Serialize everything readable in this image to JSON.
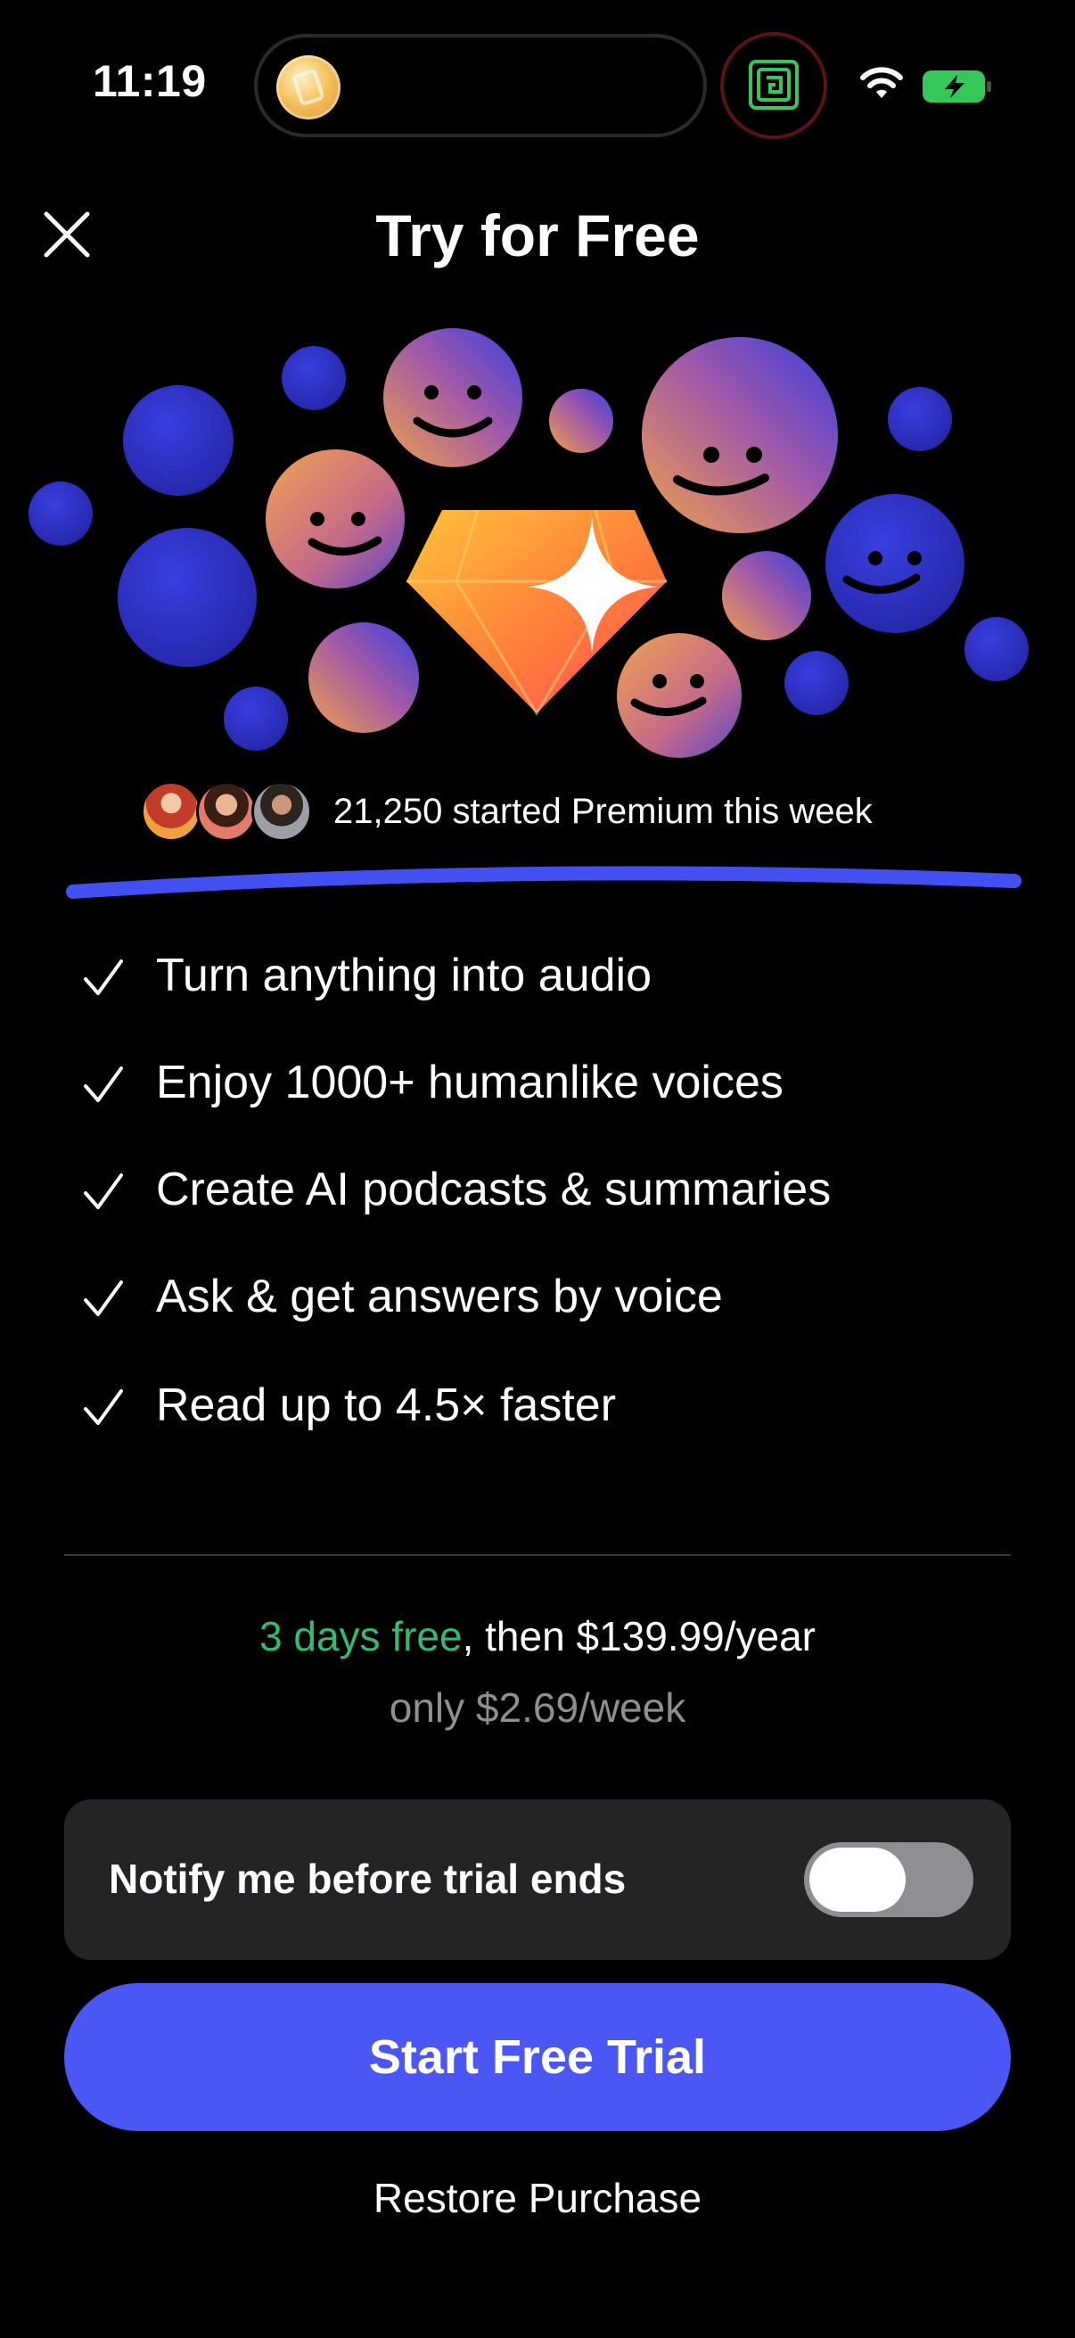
{
  "status_bar": {
    "time": "11:19",
    "icons": [
      "coin-app-icon",
      "screen-record-icon",
      "wifi-icon",
      "battery-charging-icon"
    ]
  },
  "header": {
    "title": "Try for Free",
    "close_icon": "close-icon"
  },
  "social_proof": {
    "text": "21,250 started Premium this week"
  },
  "features": [
    {
      "icon": "check-icon",
      "label": "Turn anything into audio"
    },
    {
      "icon": "check-icon",
      "label": "Enjoy 1000+ humanlike voices"
    },
    {
      "icon": "check-icon",
      "label": "Create AI podcasts & summaries"
    },
    {
      "icon": "check-icon",
      "label": "Ask & get answers by voice"
    },
    {
      "icon": "check-icon",
      "label": "Read up to 4.5× faster"
    }
  ],
  "pricing": {
    "trial": "3 days free",
    "then": ", then $139.99/year",
    "weekly": "only $2.69/week"
  },
  "notify": {
    "label": "Notify me before trial ends",
    "enabled": false
  },
  "cta": {
    "label": "Start Free Trial"
  },
  "restore": {
    "label": "Restore Purchase"
  },
  "colors": {
    "background": "#000000",
    "accent": "#4b57f4",
    "trial_green": "#2ebd72",
    "muted": "#8e8e93",
    "card": "#242426"
  }
}
